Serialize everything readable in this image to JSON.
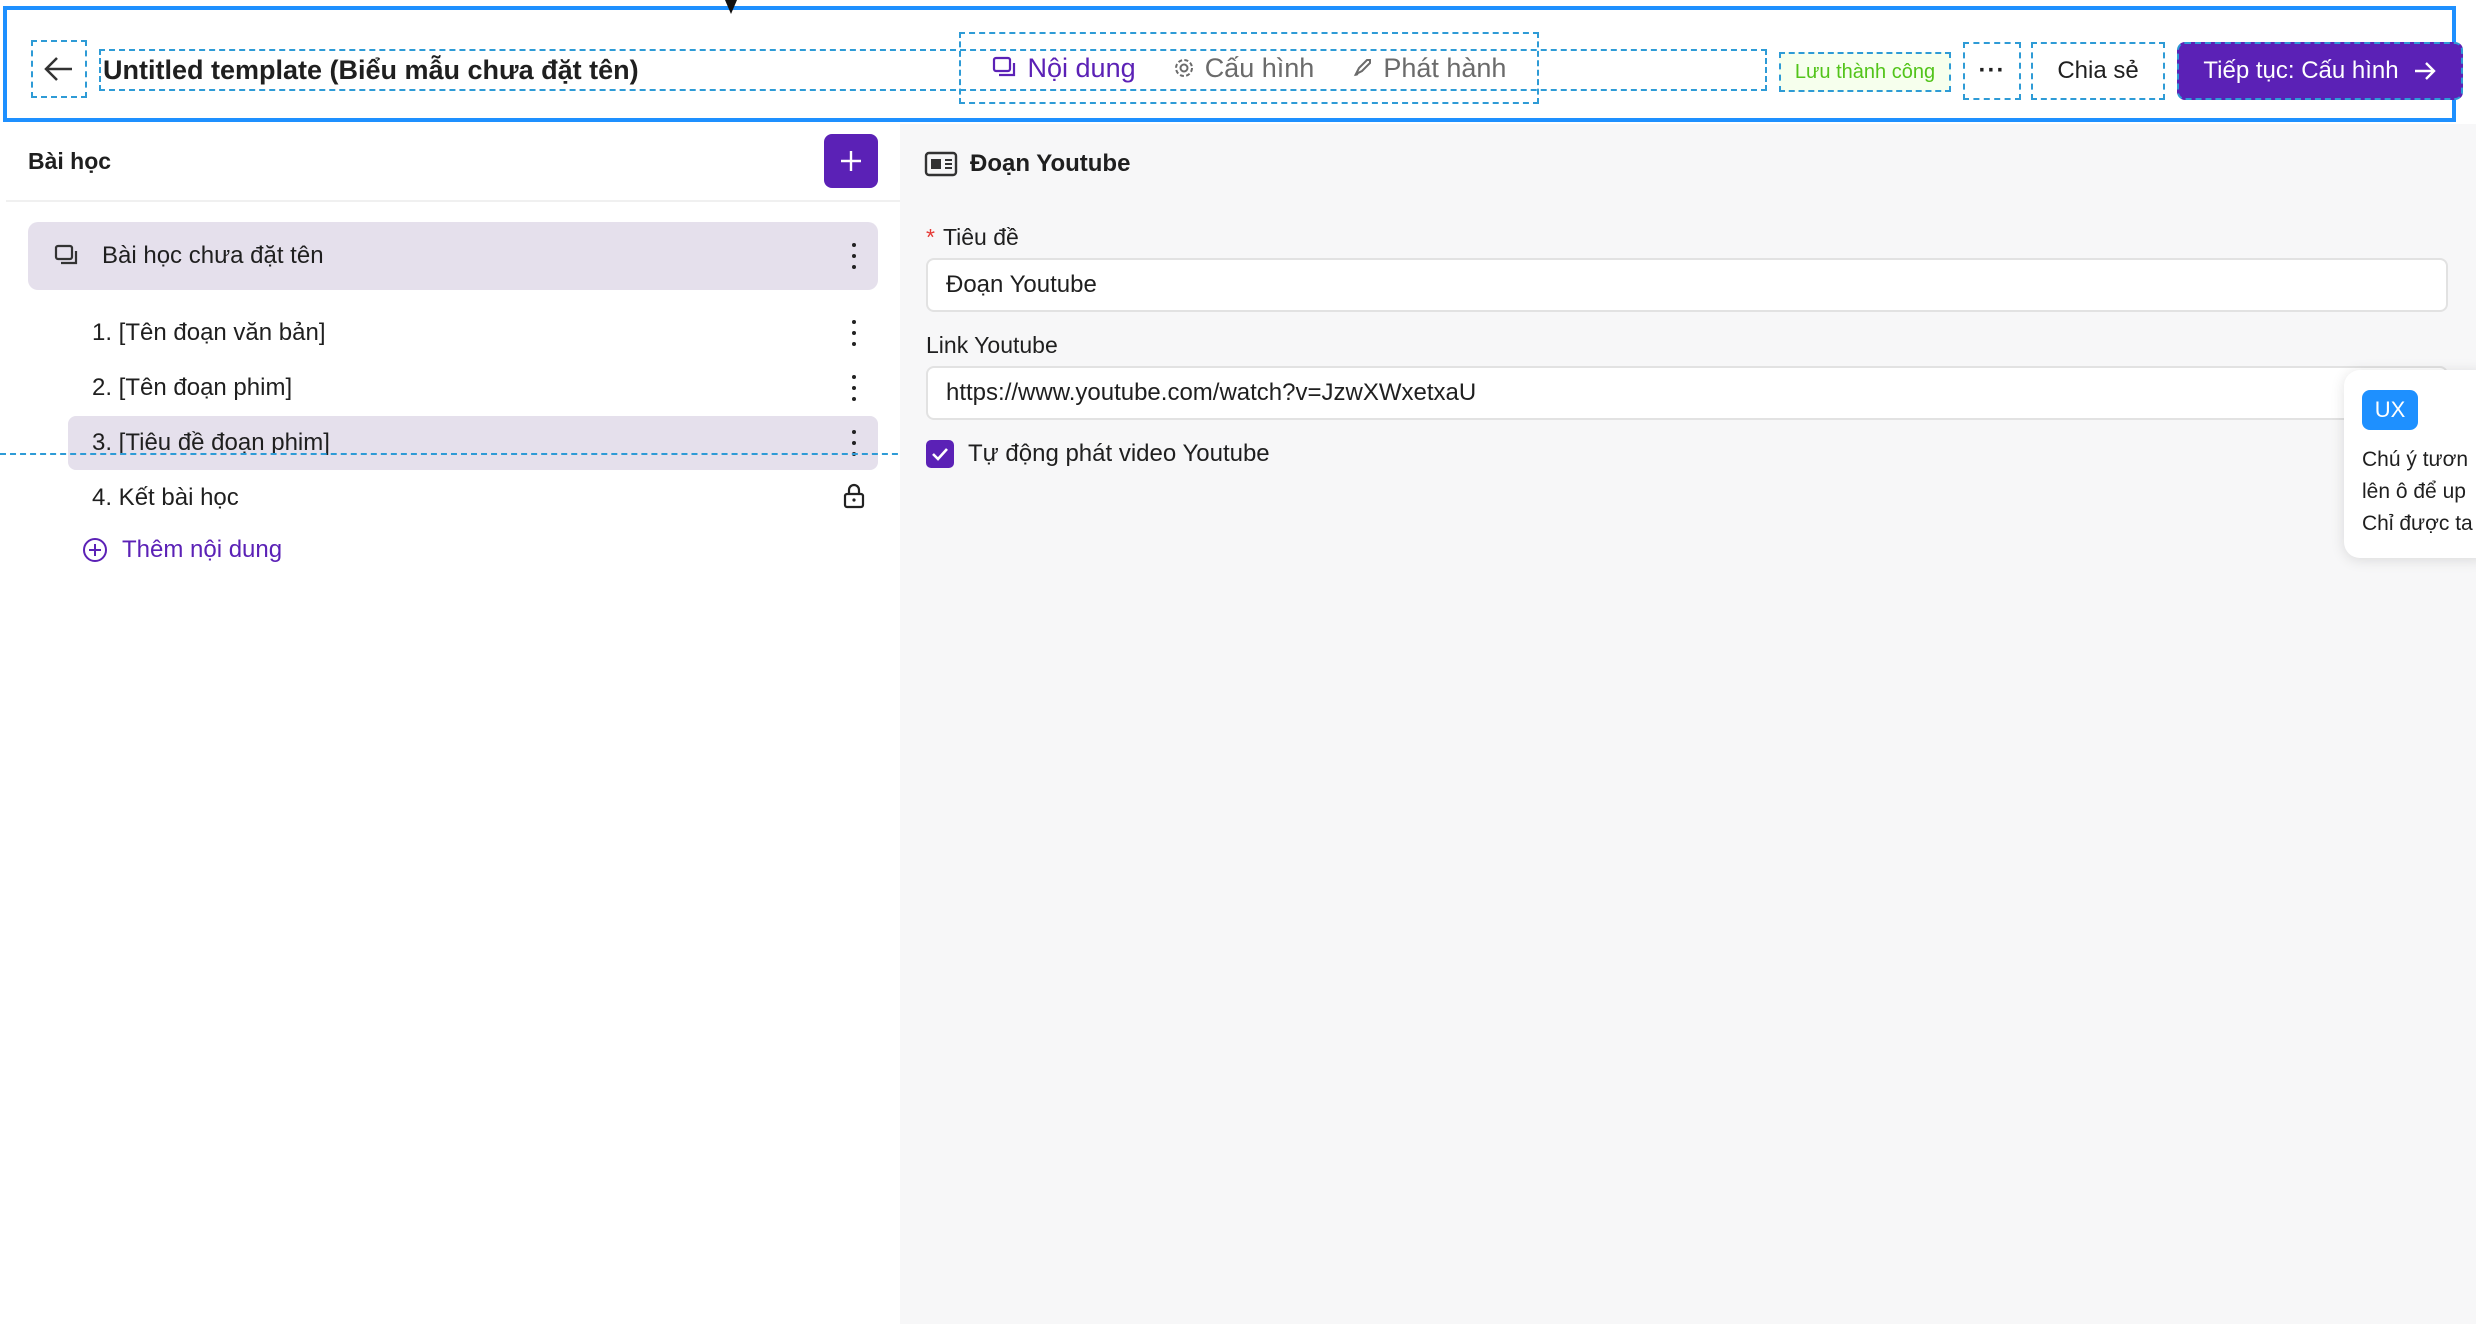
{
  "header": {
    "title": "Untitled template (Biểu mẫu chưa đặt tên)",
    "tabs": [
      {
        "label": "Nội dung",
        "icon": "content-icon",
        "active": true
      },
      {
        "label": "Cấu hình",
        "icon": "gear-icon",
        "active": false
      },
      {
        "label": "Phát hành",
        "icon": "rocket-icon",
        "active": false
      }
    ],
    "save_status": "Lưu thành công",
    "more_label": "···",
    "share_label": "Chia sẻ",
    "continue_label": "Tiếp tục: Cấu hình"
  },
  "sidebar": {
    "title": "Bài học",
    "lesson": {
      "label": "Bài học chưa đặt tên"
    },
    "items": [
      {
        "label": "1. [Tên đoạn văn bản]",
        "locked": false
      },
      {
        "label": "2. [Tên đoạn phim]",
        "locked": false
      },
      {
        "label": "3. [Tiêu đề đoạn phim]",
        "locked": false,
        "selected": true
      },
      {
        "label": "4. Kết bài học",
        "locked": true
      }
    ],
    "add_content_label": "Thêm nội dung"
  },
  "main": {
    "section_title": "Đoạn Youtube",
    "title_field": {
      "label": "Tiêu đề",
      "required": true,
      "value": "Đoạn Youtube"
    },
    "link_field": {
      "label": "Link Youtube",
      "value": "https://www.youtube.com/watch?v=JzwXWxetxaU"
    },
    "autoplay": {
      "label": "Tự động phát video Youtube",
      "checked": true
    }
  },
  "popup": {
    "badge": "UX",
    "lines": [
      "Chú ý tươn",
      "lên ô để up",
      "Chỉ được ta"
    ]
  },
  "colors": {
    "accent": "#5b21b6",
    "selection_bg": "#e5e0ec",
    "success": "#52c41a",
    "outline": "#1e90ff"
  }
}
